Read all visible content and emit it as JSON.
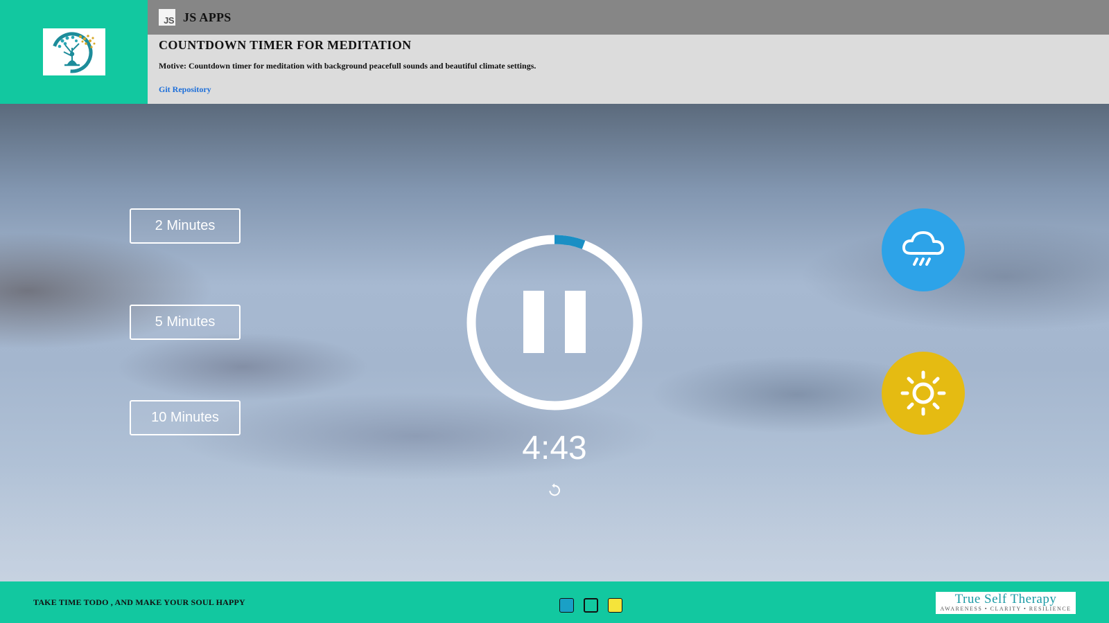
{
  "header": {
    "brand_logo_icon": "meditation-tree-logo",
    "js_badge": "JS",
    "app_name": "JS APPS",
    "title": "COUNTDOWN TIMER FOR MEDITATION",
    "motive": "Motive: Countdown timer for meditation with background peacefull sounds and beautiful climate settings.",
    "repo_link": "Git Repository"
  },
  "timer": {
    "options": [
      "2 Minutes",
      "5 Minutes",
      "10 Minutes"
    ],
    "time_display": "4:43",
    "progress_fraction": 0.057,
    "state_icon": "pause-icon",
    "reset_icon": "replay-icon"
  },
  "climate": {
    "rain_icon": "rain-cloud-icon",
    "sun_icon": "sun-icon",
    "rain_color": "#2da3e8",
    "sun_color": "#e5bb12"
  },
  "footer": {
    "tagline": "TAKE TIME TODO , AND MAKE YOUR SOUL HAPPY",
    "theme_swatches": [
      "#1aa0c6",
      "#12c8a0",
      "#f5e43a"
    ],
    "therapy_name": "True Self Therapy",
    "therapy_sub": "AWARENESS • CLARITY • RESILIENCE"
  },
  "colors": {
    "accent": "#12c8a0",
    "progress": "#1a8fc4",
    "link": "#1e6fd9"
  }
}
